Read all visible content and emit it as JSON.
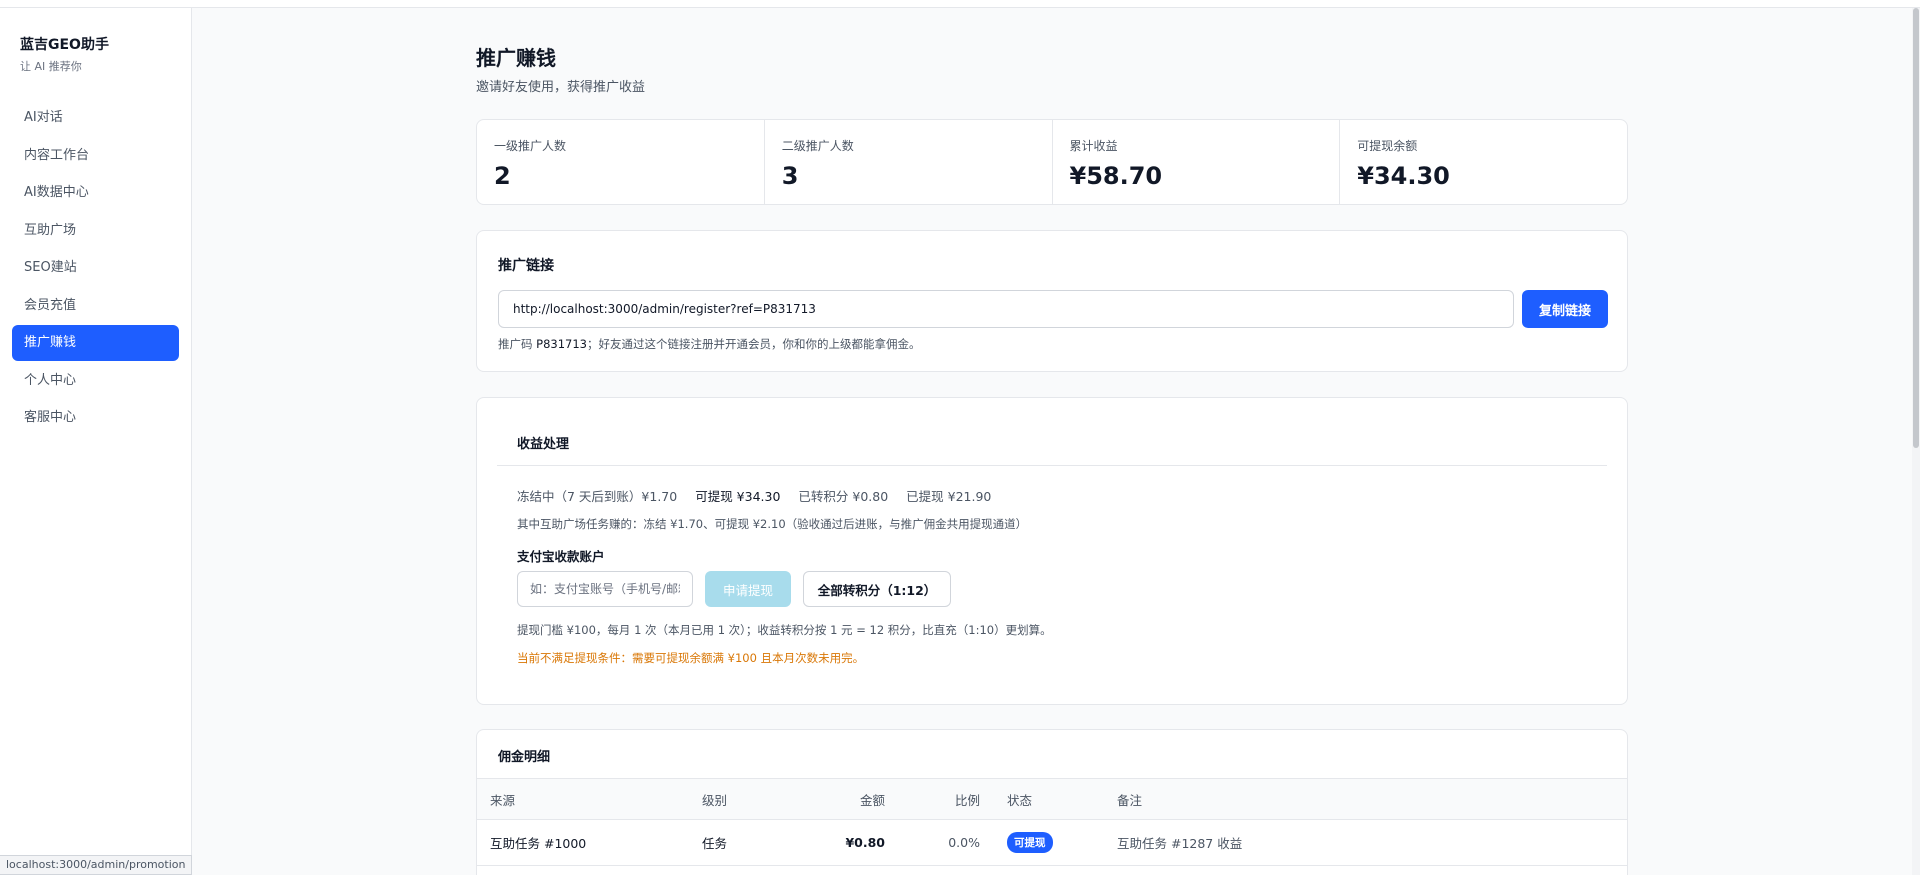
{
  "sidebar": {
    "brand": "蓝吉GEO助手",
    "brand_sub": "让 AI 推荐你",
    "items": [
      {
        "label": "AI对话"
      },
      {
        "label": "内容工作台"
      },
      {
        "label": "AI数据中心"
      },
      {
        "label": "互助广场"
      },
      {
        "label": "SEO建站"
      },
      {
        "label": "会员充值"
      },
      {
        "label": "推广赚钱",
        "active": true
      },
      {
        "label": "个人中心"
      },
      {
        "label": "客服中心"
      }
    ]
  },
  "page": {
    "title": "推广赚钱",
    "subtitle": "邀请好友使用，获得推广收益"
  },
  "stats": [
    {
      "label": "一级推广人数",
      "value": "2"
    },
    {
      "label": "二级推广人数",
      "value": "3"
    },
    {
      "label": "累计收益",
      "value": "¥58.70"
    },
    {
      "label": "可提现余额",
      "value": "¥34.30"
    }
  ],
  "link": {
    "title": "推广链接",
    "url": "http://localhost:3000/admin/register?ref=P831713",
    "copy_label": "复制链接",
    "note_prefix": "推广码 ",
    "code": "P831713",
    "note_suffix": "；好友通过这个链接注册并开通会员，你和你的上级都能拿佣金。"
  },
  "earnings": {
    "title": "收益处理",
    "frozen": "冻结中（7 天后到账）¥1.70",
    "withdrawable": "可提现 ¥34.30",
    "converted": "已转积分 ¥0.80",
    "withdrawn": "已提现 ¥21.90",
    "task_note": "其中互助广场任务赚的：冻结 ¥1.70、可提现 ¥2.10（验收通过后进账，与推广佣金共用提现通道）",
    "alipay_label": "支付宝收款账户",
    "alipay_placeholder": "如：支付宝账号（手机号/邮箱）",
    "withdraw_label": "申请提现",
    "convert_label": "全部转积分（1:12）",
    "rule": "提现门槛 ¥100，每月 1 次（本月已用 1 次）；收益转积分按 1 元 = 12 积分，比直充（1:10）更划算。",
    "warning": "当前不满足提现条件：需要可提现余额满 ¥100 且本月次数未用完。"
  },
  "commission": {
    "title": "佣金明细",
    "headers": {
      "source": "来源",
      "level": "级别",
      "amount": "金额",
      "ratio": "比例",
      "status": "状态",
      "remark": "备注"
    },
    "rows": [
      {
        "source": "互助任务 #1000",
        "level": "任务",
        "amount": "¥0.80",
        "ratio": "0.0%",
        "status": "可提现",
        "remark": "互助任务 #1287 收益"
      }
    ]
  },
  "status_bar": {
    "url": "localhost:3000/admin/promotion"
  },
  "colors": {
    "accent": "#1e5eff",
    "warning": "#d97706",
    "disabled_button": "#a8dcec"
  }
}
